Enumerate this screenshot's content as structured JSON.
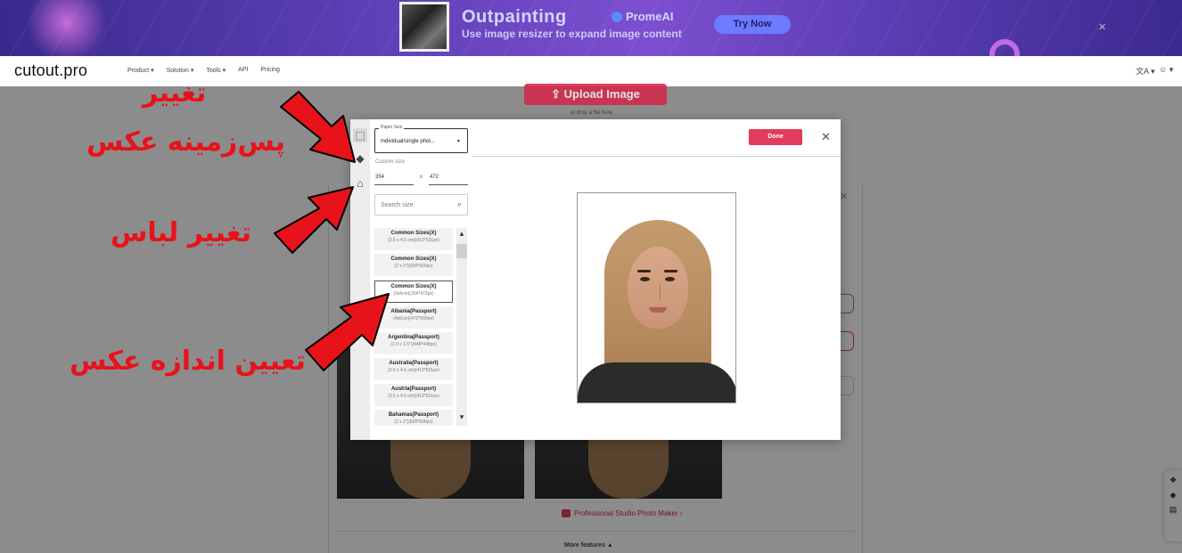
{
  "ad": {
    "title": "Outpainting",
    "subtitle": "Use image resizer to expand image content",
    "brand": "PromeAI",
    "cta": "Try Now",
    "close": "✕"
  },
  "nav": {
    "logo": "cutout.pro",
    "links": [
      "Product ▾",
      "Solution ▾",
      "Tools ▾",
      "API",
      "Pricing"
    ],
    "lang_icon": "文A ▾",
    "user_icon": "☺ ▾"
  },
  "background": {
    "upload_label": "⇪  Upload Image",
    "drop_hint": "or drop a file here",
    "studio_link": "Professional Studio Photo Maker ›",
    "more_features": "More features ▲",
    "close": "✕"
  },
  "modal": {
    "paper_size": {
      "legend": "Paper Size",
      "value": "Individual/single phot...",
      "caret": "▾"
    },
    "custom_size_label": "Custom size",
    "width": "354",
    "height": "472",
    "size_separator": "x",
    "search_placeholder": "Search size",
    "search_icon": "⌕",
    "done_label": "Done",
    "close": "✕",
    "tools": {
      "crop_icon": "⬚",
      "bucket_icon": "◆",
      "shirt_icon": "⌂"
    },
    "sizes": [
      {
        "name": "Common Sizes(X)",
        "dims": "(3.5 x 4.5 cm)(413*531px)"
      },
      {
        "name": "Common Sizes(X)",
        "dims": "(2 x 2\")(600*600px)"
      },
      {
        "name": "Common Sizes(X)",
        "dims": "(3x4cm)(354*472px)"
      },
      {
        "name": "Albania(Passport)",
        "dims": "(4x5cm)(472*590px)"
      },
      {
        "name": "Argentina(Passport)",
        "dims": "(1.5 x 1.5\")(448*448px)"
      },
      {
        "name": "Australia(Passport)",
        "dims": "(3.5 x 4.5 cm)(413*531px)"
      },
      {
        "name": "Austria(Passport)",
        "dims": "(3.5 x 4.5 cm)(413*531px)"
      },
      {
        "name": "Bahamas(Passport)",
        "dims": "(2 x 2\")(600*600px)"
      }
    ],
    "selected_index": 2,
    "scroll_up": "▴",
    "scroll_down": "▾"
  },
  "annotations": {
    "change_background_line1": "تغییر",
    "change_background_line2": "پس‌زمینه عکس",
    "change_clothes": "تغییر لباس",
    "set_photo_size": "تعیین اندازه عکس",
    "color": "#e8121b"
  },
  "side_widget": [
    "❖",
    "☻",
    "▤"
  ]
}
